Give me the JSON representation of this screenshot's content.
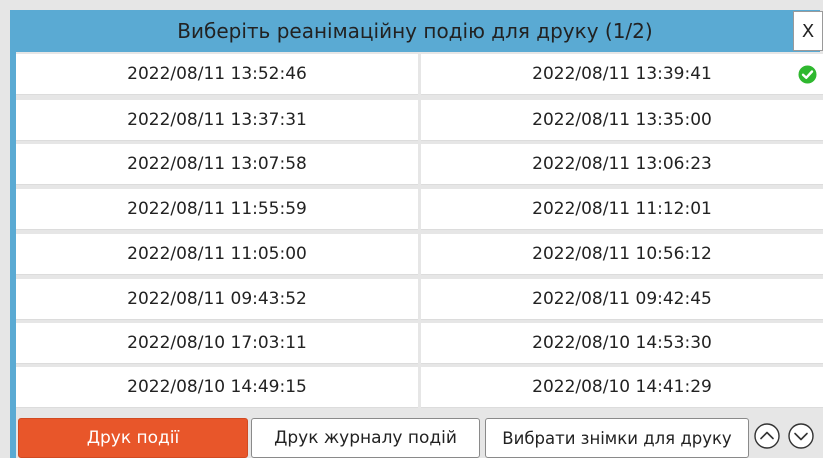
{
  "dialog": {
    "title": "Виберіть реанімаційну подію для друку (1/2)",
    "close_label": "X"
  },
  "events": [
    "2022/08/11 13:52:46",
    "2022/08/11 13:39:41",
    "2022/08/11 13:37:31",
    "2022/08/11 13:35:00",
    "2022/08/11 13:07:58",
    "2022/08/11 13:06:23",
    "2022/08/11 11:55:59",
    "2022/08/11 11:12:01",
    "2022/08/11 11:05:00",
    "2022/08/11 10:56:12",
    "2022/08/11 09:43:52",
    "2022/08/11 09:42:45",
    "2022/08/10 17:03:11",
    "2022/08/10 14:53:30",
    "2022/08/10 14:49:15",
    "2022/08/10 14:41:29"
  ],
  "selected_event": "2022/08/11 13:39:41",
  "buttons": {
    "print_event": "Друк події",
    "print_log": "Друк журналу подій",
    "select_snapshots": "Вибрати знімки для друку"
  },
  "icons": {
    "selected": "check-circle-icon",
    "page_up": "chevron-up-circle-icon",
    "page_down": "chevron-down-circle-icon"
  },
  "colors": {
    "title_bar": "#5aaad3",
    "primary_button": "#e8562a",
    "selected_check": "#2fb82f"
  }
}
